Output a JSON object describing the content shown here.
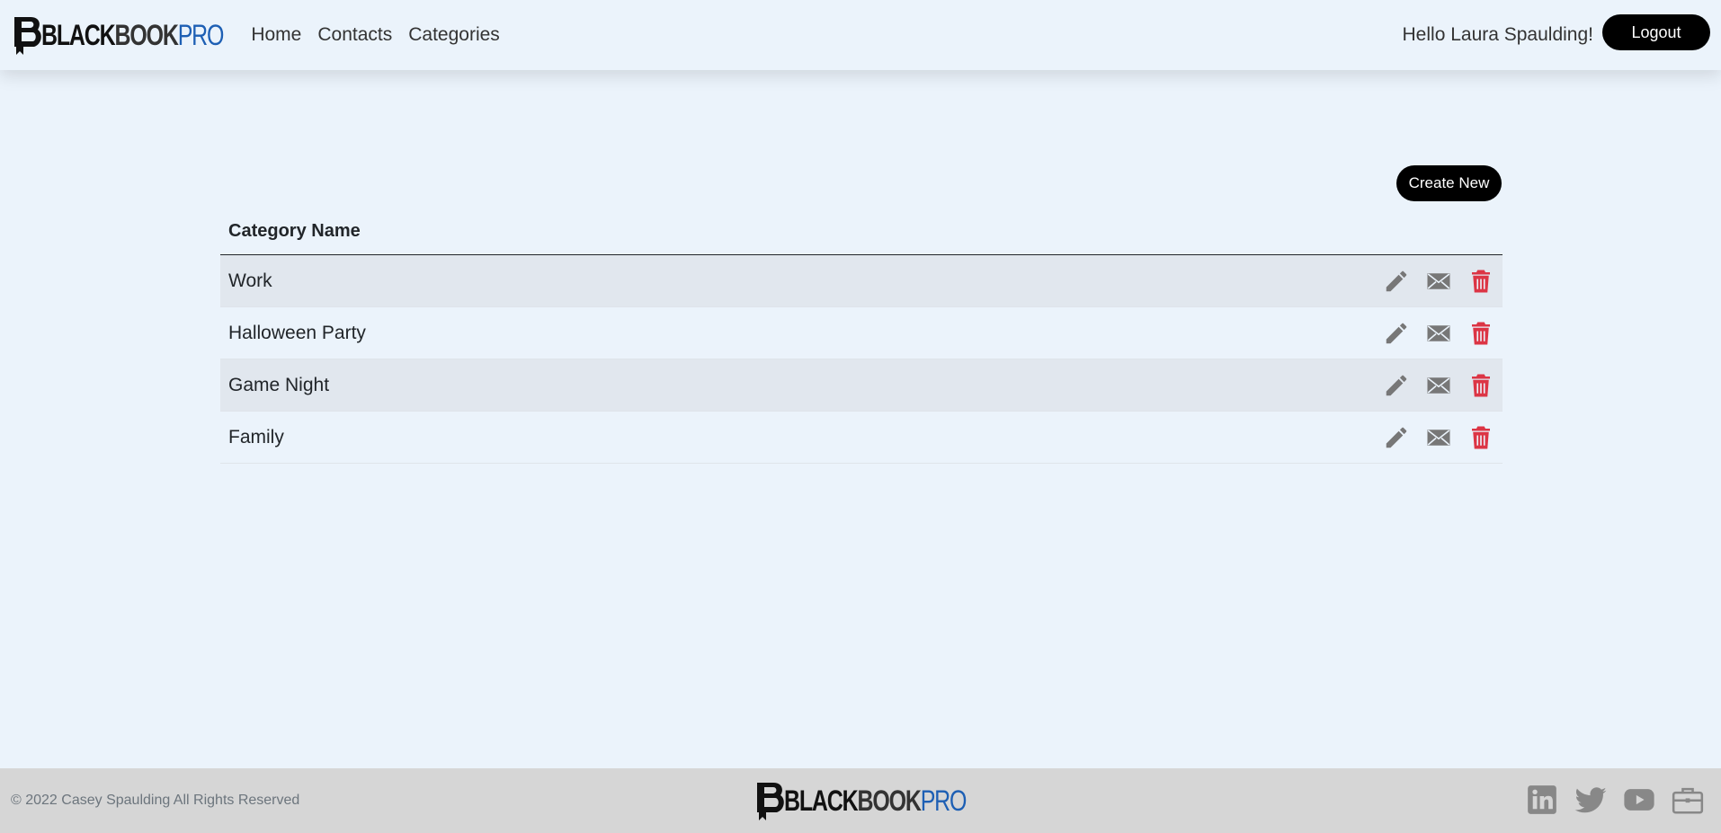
{
  "brand": {
    "black": "BLACK",
    "book": "BOOK",
    "pro": "PRO",
    "accent_color": "#1d5fb4"
  },
  "nav": {
    "links": [
      "Home",
      "Contacts",
      "Categories"
    ]
  },
  "user": {
    "greeting": "Hello Laura Spaulding!",
    "logout_label": "Logout"
  },
  "main": {
    "create_label": "Create New",
    "table": {
      "header": "Category Name",
      "rows": [
        "Work",
        "Halloween Party",
        "Game Night",
        "Family"
      ],
      "row_actions": [
        "pencil-icon",
        "envelope-icon",
        "trash-icon"
      ]
    }
  },
  "footer": {
    "copyright": "© 2022 Casey Spaulding All Rights Reserved",
    "social": [
      "linkedin-icon",
      "twitter-icon",
      "youtube-icon",
      "briefcase-icon"
    ]
  },
  "colors": {
    "delete": "#dc3545",
    "action_gray": "#777777",
    "button_bg": "#000000"
  }
}
